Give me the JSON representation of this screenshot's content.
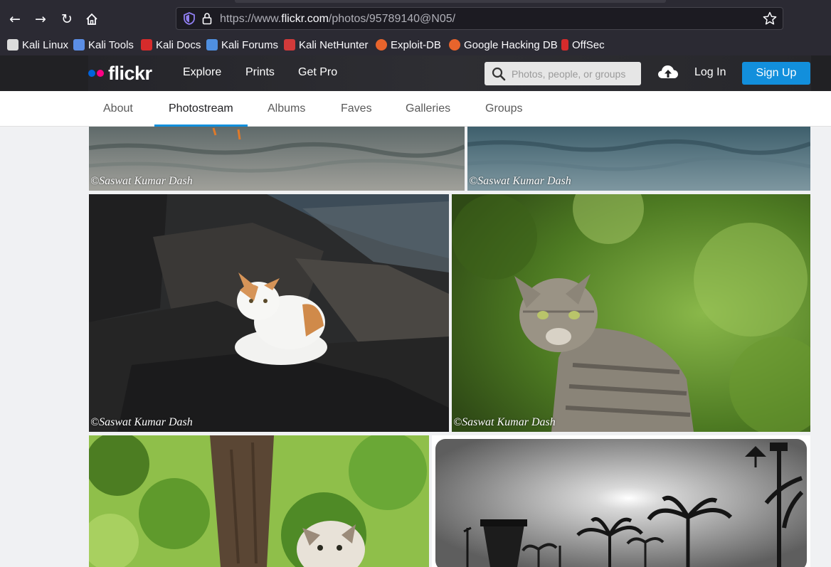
{
  "browser": {
    "url_prefix": "https://www.",
    "url_domain": "flickr.com",
    "url_path": "/photos/95789140@N05/",
    "bookmarks": [
      {
        "label": "Kali Linux",
        "color": "#dcdcdc"
      },
      {
        "label": "Kali Tools",
        "color": "#5b8ee6"
      },
      {
        "label": "Kali Docs",
        "color": "#d62b2b"
      },
      {
        "label": "Kali Forums",
        "color": "#4f8fe0"
      },
      {
        "label": "Kali NetHunter",
        "color": "#d33a3a"
      },
      {
        "label": "Exploit-DB",
        "color": "#e8642c"
      },
      {
        "label": "Google Hacking DB",
        "color": "#e8642c"
      },
      {
        "label": "OffSec",
        "color": "#d62b2b"
      }
    ]
  },
  "header": {
    "logo": "flickr",
    "nav": [
      "Explore",
      "Prints",
      "Get Pro"
    ],
    "search_placeholder": "Photos, people, or groups",
    "login": "Log In",
    "signup": "Sign Up",
    "brand_blue": "#0063dc",
    "brand_pink": "#ff0084"
  },
  "subnav": {
    "tabs": [
      "About",
      "Photostream",
      "Albums",
      "Faves",
      "Galleries",
      "Groups"
    ],
    "active": "Photostream"
  },
  "photos": [
    {
      "subject": "water-ripples-top-left",
      "credit": "©Saswat Kumar Dash"
    },
    {
      "subject": "water-ripples-top-right",
      "credit": "©Saswat Kumar Dash"
    },
    {
      "subject": "white-orange-cat-on-rocks",
      "credit": "©Saswat Kumar Dash"
    },
    {
      "subject": "tabby-cat-green-background",
      "credit": "©Saswat Kumar Dash"
    },
    {
      "subject": "kitten-in-tree",
      "credit": ""
    },
    {
      "subject": "monochrome-palm-trees-sun",
      "credit": ""
    }
  ]
}
